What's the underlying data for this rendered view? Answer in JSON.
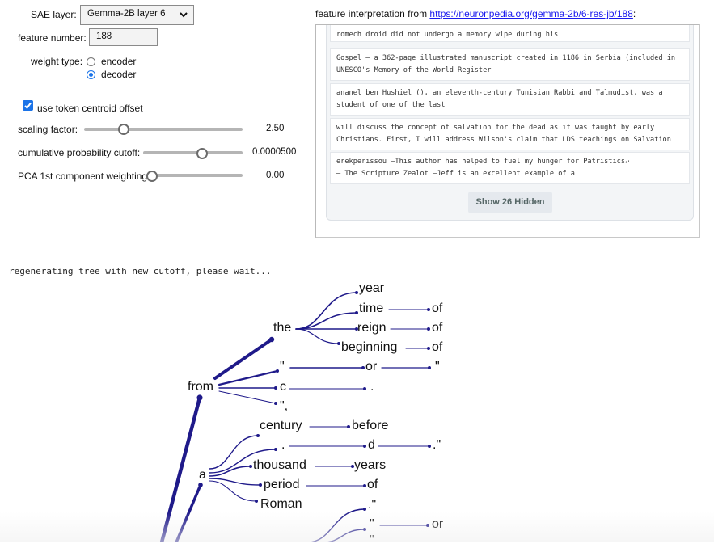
{
  "controls": {
    "sae_layer_label": "SAE layer:",
    "sae_layer_value": "Gemma-2B layer 6",
    "feature_number_label": "feature number:",
    "feature_number_value": "188",
    "weight_type_label": "weight type:",
    "weight_options": [
      "encoder",
      "decoder"
    ],
    "weight_selected": "decoder",
    "token_centroid_label": "use token centroid offset",
    "token_centroid_checked": true,
    "scaling_factor_label": "scaling factor:",
    "scaling_factor_value": "2.50",
    "cutoff_label": "cumulative probability cutoff:",
    "cutoff_value": "0.0000500",
    "pca_label": "PCA 1st component weighting",
    "pca_value": "0.00"
  },
  "interpretation": {
    "prefix": "feature interpretation from ",
    "link": "https://neuronpedia.org/gemma-2b/6-res-jb/188",
    "suffix": ":",
    "examples": [
      "romech droid did not undergo a memory wipe during his",
      "Gospel – a 362-page illustrated manuscript created in 1186 in Serbia (included in\nUNESCO's Memory of the World Register",
      "ananel ben Hushiel (), an eleventh-century Tunisian Rabbi and Talmudist, was a\nstudent of one of the last",
      "will discuss the concept of salvation for the dead as it was taught by early\nChristians. First, I will address Wilson's claim that LDS teachings on Salvation",
      "erekperissou –This author has helped to fuel my hunger for Patristics↵\n– The Scripture Zealot –Jeff is an excellent example of a"
    ],
    "show_hidden_label": "Show 26 Hidden"
  },
  "status_text": "regenerating tree with new cutoff, please wait...",
  "tree": {
    "words": {
      "from": "from",
      "the": "the",
      "year": "year",
      "time": "time",
      "reign": "reign",
      "beginning": "beginning",
      "of1": "of",
      "of2": "of",
      "of3": "of",
      "q1": "\"",
      "or1": "or",
      "q2": "\"",
      "c": "c",
      "dot1": ".",
      "qc": "\",",
      "a": "a",
      "century": "century",
      "before": "before",
      "dot2": ".",
      "d": "d",
      "dq": ".\"",
      "thousand": "thousand",
      "years": "years",
      "period": "period",
      "of4": "of",
      "roman": "Roman",
      "dq2": ".\"",
      "q3": "\"",
      "or2": "or",
      "q4": "\""
    },
    "line_color": "#1f1a8a"
  }
}
